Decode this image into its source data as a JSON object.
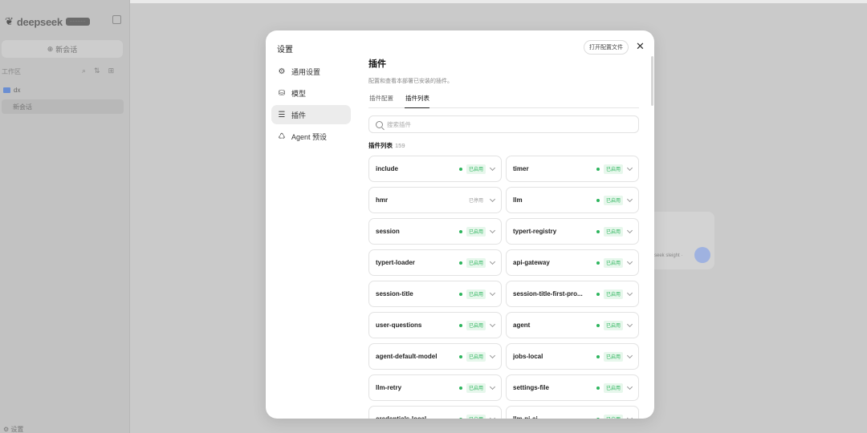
{
  "app": {
    "logo_text": "deepseek",
    "logo_badge": "··········",
    "new_chat_label": "新会话",
    "projects_label": "工作区",
    "project_name": "dx",
    "session_label": "新会话",
    "settings_label": "设置",
    "hint_text": "seek sleight ·"
  },
  "modal": {
    "title": "设置",
    "open_config_label": "打开配置文件",
    "close_symbol": "✕",
    "nav": [
      {
        "label": "通用设置",
        "icon": "gear-icon",
        "glyph": "⚙"
      },
      {
        "label": "模型",
        "icon": "database-icon",
        "glyph": "⛁"
      },
      {
        "label": "插件",
        "icon": "sliders-icon",
        "glyph": "☰"
      },
      {
        "label": "Agent 预设",
        "icon": "recycle-icon",
        "glyph": "♺"
      }
    ],
    "active_nav": 2
  },
  "plugins": {
    "title": "插件",
    "description": "配置和查看本部署已安装的插件。",
    "tabs": [
      "插件配置",
      "插件列表"
    ],
    "active_tab": 1,
    "search_placeholder": "搜索插件",
    "list_title": "插件列表",
    "count": "159",
    "items": [
      {
        "name": "include",
        "status": "已启用",
        "enabled": true
      },
      {
        "name": "timer",
        "status": "已启用",
        "enabled": true
      },
      {
        "name": "hmr",
        "status": "已停用",
        "enabled": false
      },
      {
        "name": "llm",
        "status": "已启用",
        "enabled": true
      },
      {
        "name": "session",
        "status": "已启用",
        "enabled": true
      },
      {
        "name": "typert-registry",
        "status": "已启用",
        "enabled": true
      },
      {
        "name": "typert-loader",
        "status": "已启用",
        "enabled": true
      },
      {
        "name": "api-gateway",
        "status": "已启用",
        "enabled": true
      },
      {
        "name": "session-title",
        "status": "已启用",
        "enabled": true
      },
      {
        "name": "session-title-first-pro...",
        "status": "已启用",
        "enabled": true
      },
      {
        "name": "user-questions",
        "status": "已启用",
        "enabled": true
      },
      {
        "name": "agent",
        "status": "已启用",
        "enabled": true
      },
      {
        "name": "agent-default-model",
        "status": "已启用",
        "enabled": true
      },
      {
        "name": "jobs-local",
        "status": "已启用",
        "enabled": true
      },
      {
        "name": "llm-retry",
        "status": "已启用",
        "enabled": true
      },
      {
        "name": "settings-file",
        "status": "已启用",
        "enabled": true
      },
      {
        "name": "credentials-local",
        "status": "已启用",
        "enabled": true
      },
      {
        "name": "llm-pi-ai",
        "status": "已启用",
        "enabled": true
      }
    ]
  }
}
